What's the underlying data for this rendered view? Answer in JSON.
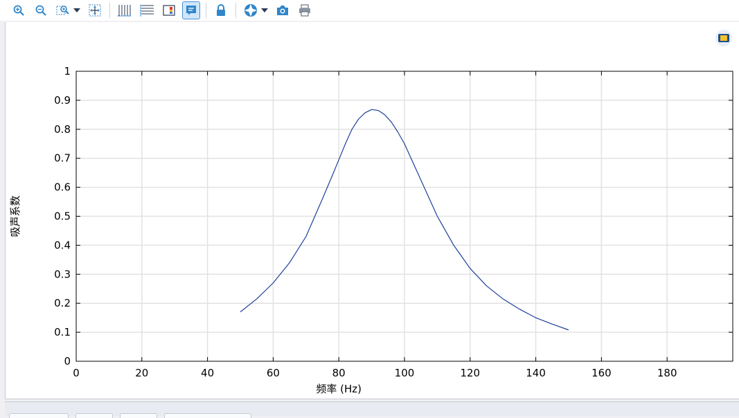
{
  "toolbar": {
    "buttons": [
      {
        "icon": "zoom-in-icon"
      },
      {
        "icon": "zoom-out-icon"
      },
      {
        "icon": "zoom-box-icon",
        "dropdown": true
      },
      {
        "icon": "zoom-extents-icon"
      },
      {
        "icon": "x-grid-icon"
      },
      {
        "icon": "y-grid-icon"
      },
      {
        "icon": "color-legend-icon"
      },
      {
        "icon": "legend-icon",
        "active": true
      },
      {
        "icon": "lock-icon"
      },
      {
        "icon": "scene-light-icon",
        "dropdown": true
      },
      {
        "icon": "camera-icon"
      },
      {
        "icon": "print-icon"
      }
    ],
    "accent_color": "#2f86c9"
  },
  "chart_data": {
    "type": "line",
    "title": "",
    "xlabel": "频率 (Hz)",
    "ylabel": "吸声系数",
    "xlim": [
      0,
      200
    ],
    "ylim": [
      0,
      1
    ],
    "xticks": [
      "0",
      "20",
      "40",
      "60",
      "80",
      "100",
      "120",
      "140",
      "160",
      "180"
    ],
    "yticks": [
      "0",
      "0.1",
      "0.2",
      "0.3",
      "0.4",
      "0.5",
      "0.6",
      "0.7",
      "0.8",
      "0.9",
      "1"
    ],
    "grid": true,
    "line_color": "#1f3f9a",
    "series": [
      {
        "x": [
          50,
          55,
          60,
          65,
          70,
          75,
          78,
          80,
          82,
          84,
          86,
          88,
          90,
          92,
          94,
          96,
          98,
          100,
          102,
          104,
          106,
          108,
          110,
          115,
          120,
          125,
          130,
          135,
          140,
          145,
          150
        ],
        "values": [
          0.17,
          0.215,
          0.27,
          0.34,
          0.43,
          0.56,
          0.64,
          0.695,
          0.75,
          0.8,
          0.835,
          0.857,
          0.868,
          0.865,
          0.85,
          0.825,
          0.79,
          0.75,
          0.7,
          0.65,
          0.6,
          0.55,
          0.5,
          0.4,
          0.32,
          0.26,
          0.215,
          0.18,
          0.15,
          0.128,
          0.108
        ]
      }
    ]
  }
}
